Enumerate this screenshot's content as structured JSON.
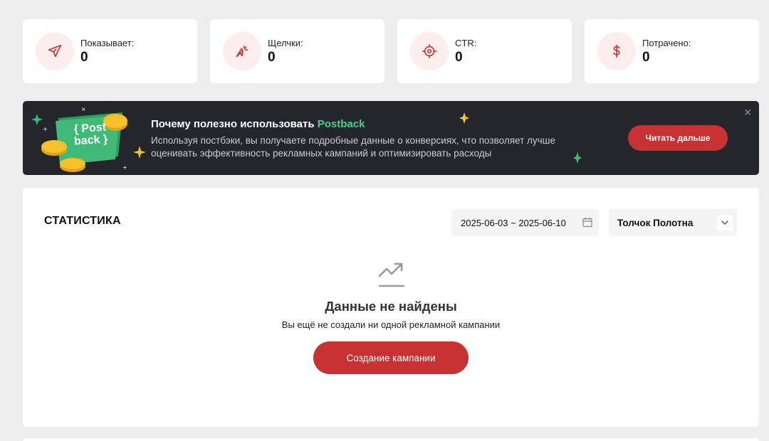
{
  "stats": [
    {
      "label": "Показывает:",
      "value": "0",
      "icon": "send-icon"
    },
    {
      "label": "Щелчки:",
      "value": "0",
      "icon": "cursor-click-icon"
    },
    {
      "label": "CTR:",
      "value": "0",
      "icon": "target-icon"
    },
    {
      "label": "Потрачено:",
      "value": "0",
      "icon": "dollar-icon"
    }
  ],
  "banner": {
    "title_prefix": "Почему полезно использовать ",
    "title_highlight": "Postback",
    "description": "Используя постбэки, вы получаете подробные данные о конверсиях, что позволяет лучше оценивать эффективность рекламных кампаний и оптимизировать расходы",
    "button_label": "Читать дальше",
    "close_label": "✕",
    "art_text_line1": "{ Post",
    "art_text_line2": "back }"
  },
  "statistics": {
    "title": "СТАТИСТИКА",
    "date_range": "2025-06-03 ~ 2025-06-10",
    "selected_site": "Толчок Полотна",
    "empty_title": "Данные не найдены",
    "empty_subtitle": "Вы ещё не создали ни одной рекламной кампании",
    "create_button_label": "Создание кампании"
  },
  "colors": {
    "accent": "#c83232",
    "icon_bg": "#fdeeee",
    "banner_bg": "#23262b",
    "highlight_green": "#4cd18a"
  }
}
